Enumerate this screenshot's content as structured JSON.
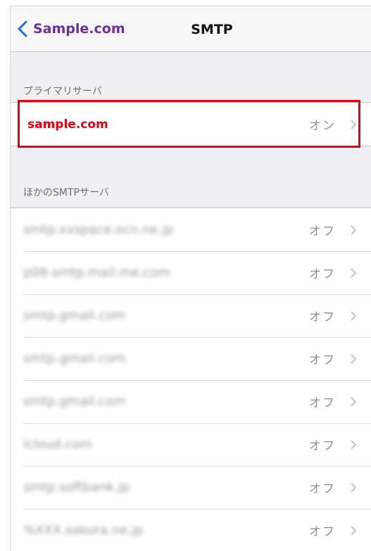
{
  "nav": {
    "back_label": "Sample.com",
    "title": "SMTP"
  },
  "primary": {
    "header": "プライマリサーバ",
    "server": "sample.com",
    "status": "オン"
  },
  "other": {
    "header": "ほかのSMTPサーバ",
    "rows": [
      {
        "server": "smtp.xxspace.ocn.ne.jp",
        "status": "オフ"
      },
      {
        "server": "p08-smtp.mail.me.com",
        "status": "オフ"
      },
      {
        "server": "smtp.gmail.com",
        "status": "オフ"
      },
      {
        "server": "smtp.gmail.com",
        "status": "オフ"
      },
      {
        "server": "smtp.gmail.com",
        "status": "オフ"
      },
      {
        "server": "icloud.com",
        "status": "オフ"
      },
      {
        "server": "smtp.softbank.jp",
        "status": "オフ"
      },
      {
        "server": "%XXX.sakura.ne.jp",
        "status": "オフ"
      }
    ]
  },
  "colors": {
    "accent": "#6b2f9c",
    "highlight": "#e60012"
  }
}
